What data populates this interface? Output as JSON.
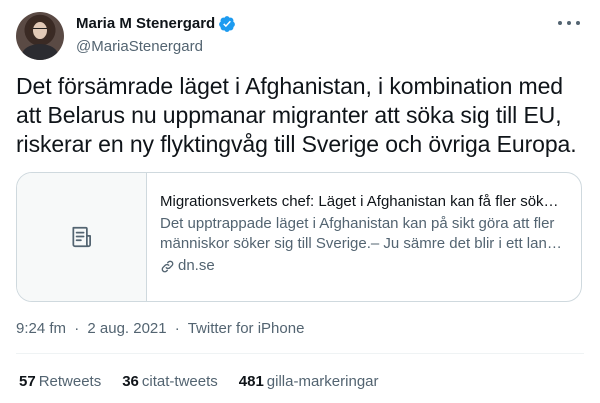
{
  "author": {
    "display_name": "Maria M Stenergard",
    "handle": "@MariaStenergard",
    "verified": true,
    "avatar_icon": "avatar-photo"
  },
  "tweet": {
    "text": "Det försämrade läget i Afghanistan, i kombination med att Belarus nu uppmanar migranter att söka sig till EU, riskerar en ny flyktingvåg till Sverige och övriga Europa."
  },
  "card": {
    "icon": "article-icon",
    "title": "Migrationsverkets chef: Läget i Afghanistan kan få fler sök…",
    "description": "Det upptrappade läget i Afghanistan kan på sikt göra att fler människor söker sig till Sverige.– Ju sämre det blir i ett lan…",
    "domain": "dn.se"
  },
  "meta": {
    "time": "9:24 fm",
    "date": "2 aug. 2021",
    "separator": "·",
    "source": "Twitter for iPhone"
  },
  "stats": [
    {
      "count": "57",
      "label": "Retweets"
    },
    {
      "count": "36",
      "label": "citat-tweets"
    },
    {
      "count": "481",
      "label": "gilla-markeringar"
    }
  ],
  "colors": {
    "text": "#0f1419",
    "secondary": "#536471",
    "verified": "#1d9bf0",
    "border": "#cfd9de"
  }
}
